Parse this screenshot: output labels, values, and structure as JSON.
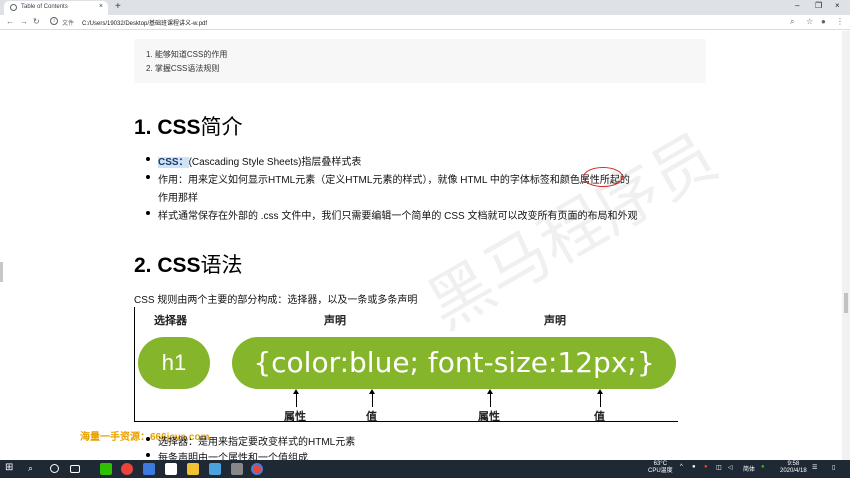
{
  "browser": {
    "tab_title": "Table of Contents",
    "tab_close": "×",
    "new_tab": "+",
    "win_min": "–",
    "win_max": "❐",
    "win_close": "×",
    "omnibox_label": "文件",
    "url": "C:/Users/19032/Desktop/基础班课程讲义-w.pdf"
  },
  "doc": {
    "objectives": [
      "1.  能够知道CSS的作用",
      "2.  掌握CSS语法规则"
    ],
    "section1": {
      "num": "1. CSS",
      "title": "简介"
    },
    "bullets1": [
      {
        "highlight": "CSS：",
        "text": "(Cascading Style Sheets)指层叠样式表"
      },
      {
        "text": "作用：用来定义如何显示HTML元素（定义HTML元素的样式），就像 HTML 中的字体标签和颜色属性所起的"
      },
      {
        "text": "作用那样"
      },
      {
        "text": "样式通常保存在外部的 .css 文件中，我们只需要编辑一个简单的 CSS 文档就可以改变所有页面的布局和外观"
      }
    ],
    "section2": {
      "num": "2. CSS",
      "title": "语法"
    },
    "syntax_intro": "CSS 规则由两个主要的部分构成：选择器，以及一条或多条声明",
    "diagram": {
      "selector_label": "选择器",
      "decl_label_1": "声明",
      "decl_label_2": "声明",
      "selector": "h1",
      "declaration": "{color:blue; font-size:12px;}",
      "prop_label_1": "属性",
      "value_label_1": "值",
      "prop_label_2": "属性",
      "value_label_2": "值"
    },
    "bullets2": [
      "选择器：是用来指定要改变样式的HTML元素",
      "每条声明由一个属性和一个值组成"
    ],
    "watermark": "海量一手资源：666java.com",
    "background_mark": "黑马程序员"
  },
  "taskbar": {
    "weather": "63°C",
    "weather_sub": "CPU温度",
    "ime": "简体",
    "time": "9:58",
    "date": "2020/4/18"
  },
  "colors": {
    "accent_green": "#84b52a",
    "highlight": "#cfe3f7",
    "taskbar": "#1f2936"
  }
}
